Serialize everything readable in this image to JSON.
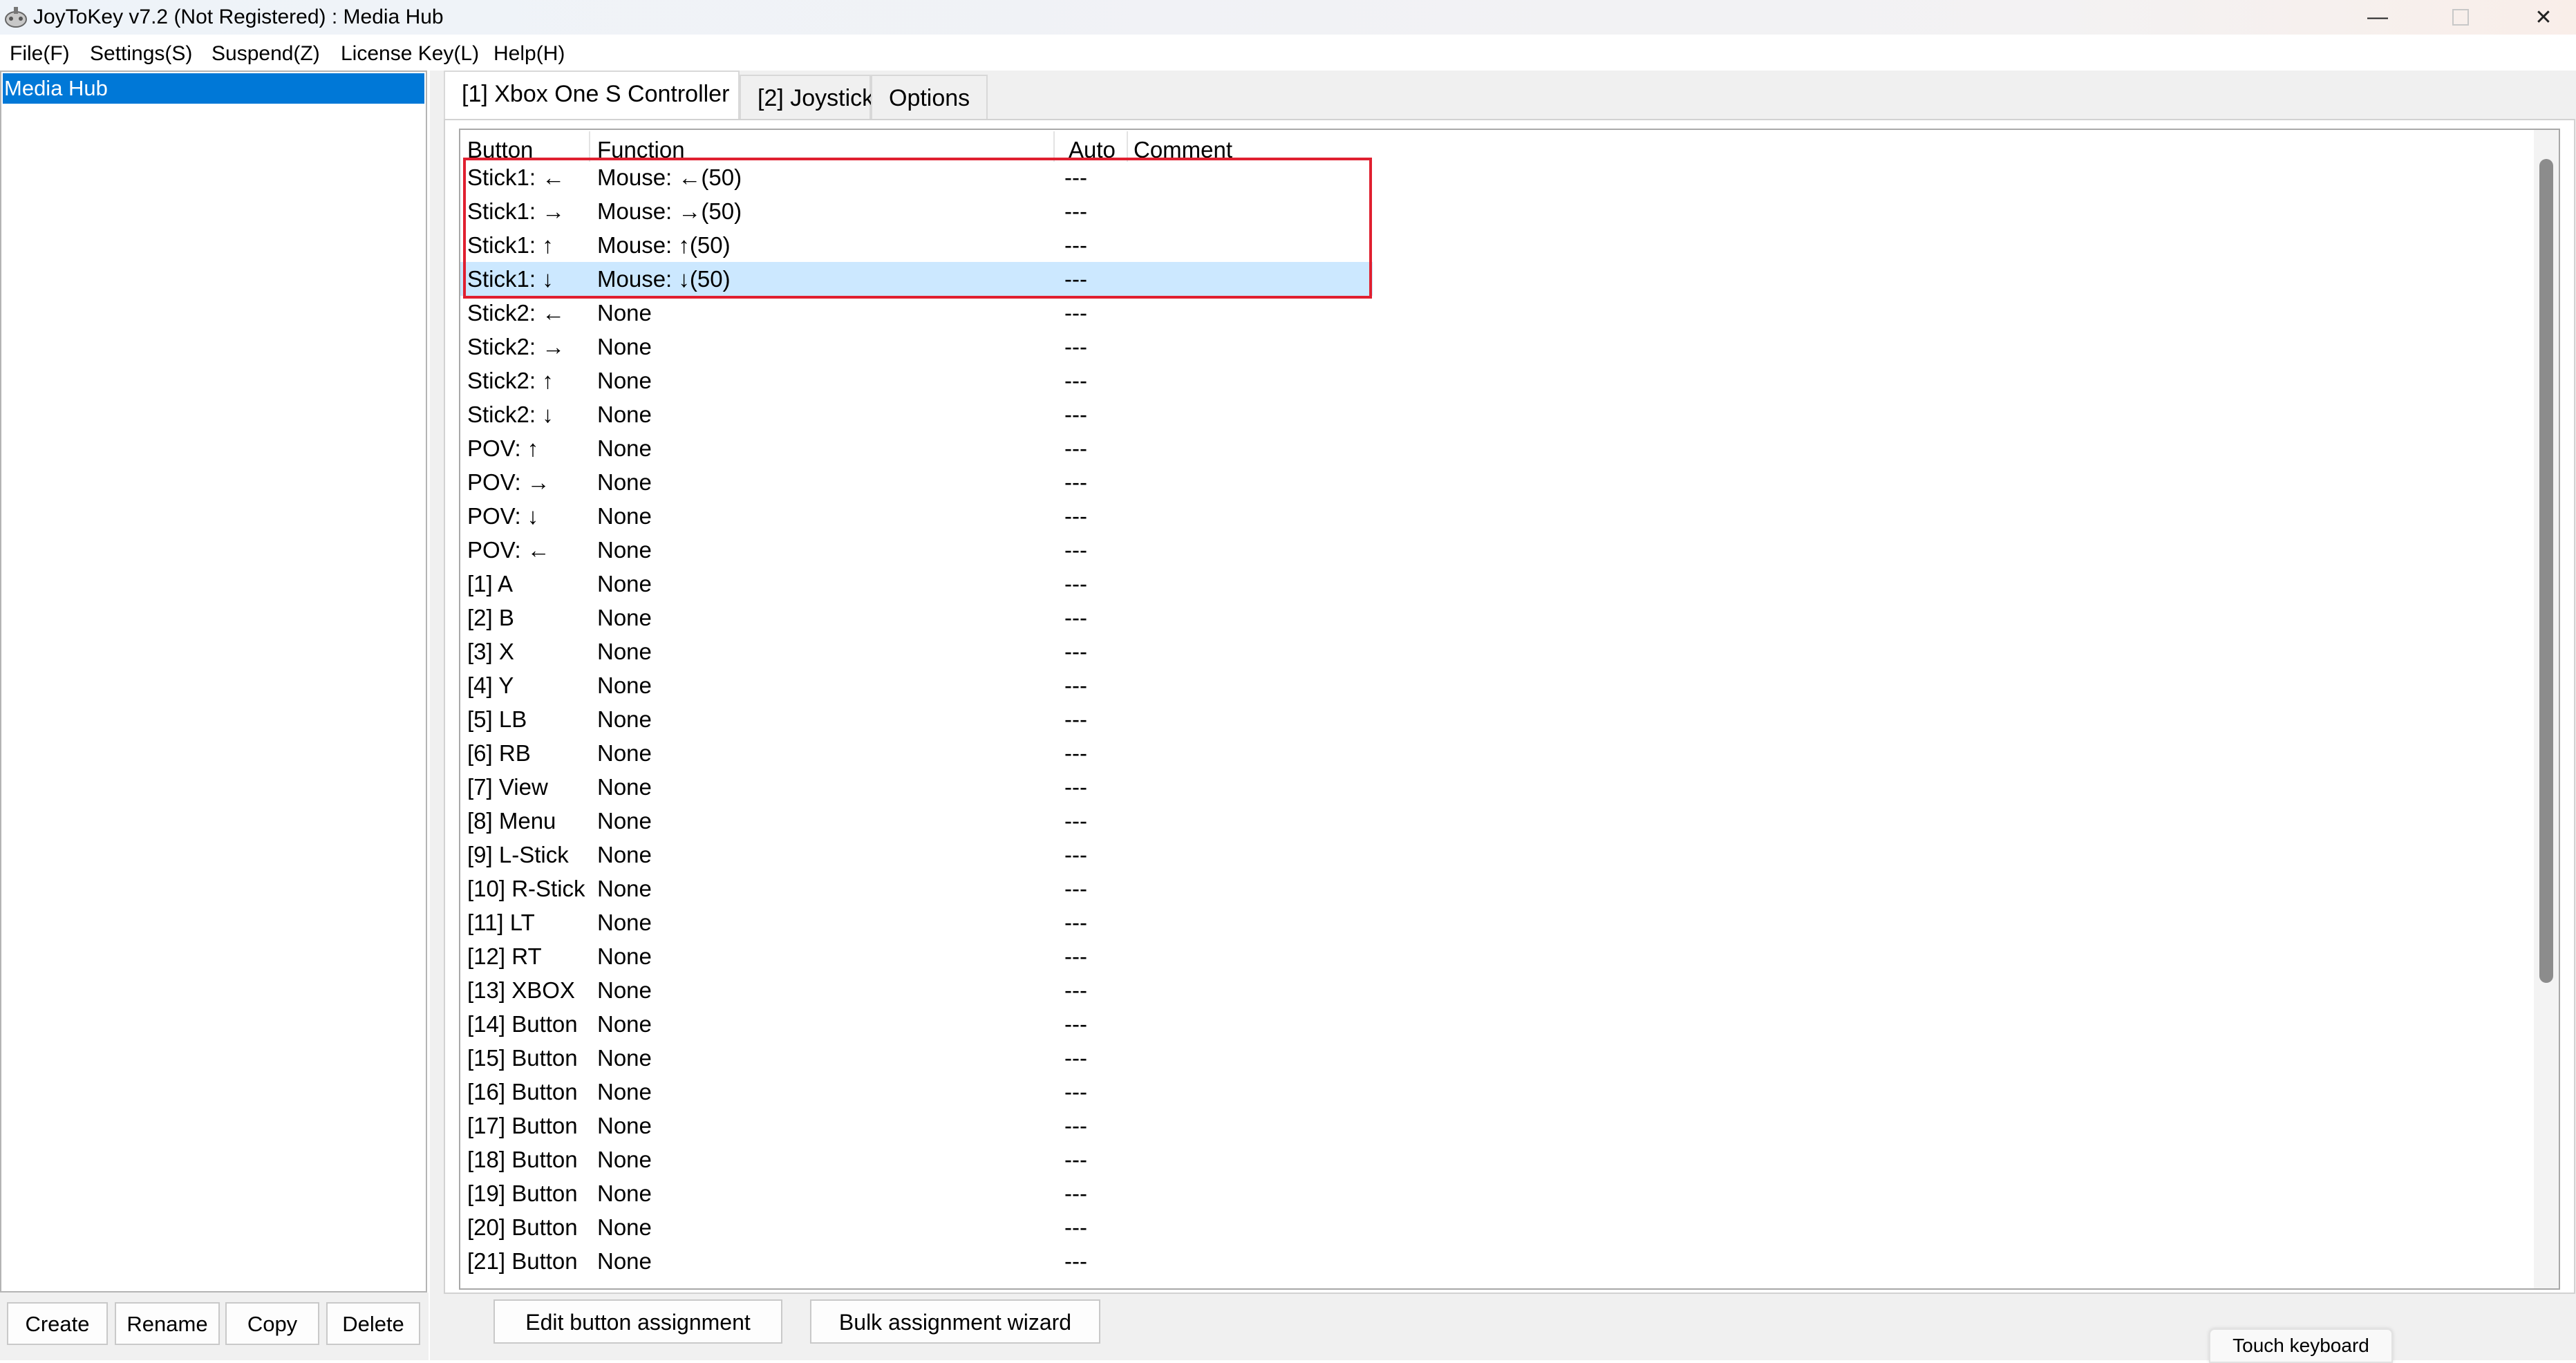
{
  "window": {
    "title": "JoyToKey v7.2 (Not Registered) : Media Hub",
    "minimize_glyph": "—",
    "close_glyph": "✕"
  },
  "menu": [
    {
      "label": "File(F)"
    },
    {
      "label": "Settings(S)"
    },
    {
      "label": "Suspend(Z)"
    },
    {
      "label": "License Key(L)"
    },
    {
      "label": "Help(H)"
    }
  ],
  "profiles": {
    "items": [
      {
        "label": "Media Hub",
        "selected": true
      }
    ],
    "buttons": {
      "create": "Create",
      "rename": "Rename",
      "copy": "Copy",
      "delete": "Delete"
    }
  },
  "tabs": [
    {
      "label": "[1] Xbox One S Controller",
      "active": true
    },
    {
      "label": "[2] Joystick",
      "active": false
    },
    {
      "label": "Options",
      "active": false
    }
  ],
  "table": {
    "headers": {
      "button": "Button",
      "function": "Function",
      "auto": "Auto",
      "comment": "Comment"
    },
    "selected_row": 3,
    "highlighted_rows": [
      0,
      1,
      2,
      3
    ],
    "rows": [
      {
        "button": "Stick1: ←",
        "function": "Mouse: ←(50)",
        "auto": "---",
        "comment": ""
      },
      {
        "button": "Stick1: →",
        "function": "Mouse: →(50)",
        "auto": "---",
        "comment": ""
      },
      {
        "button": "Stick1: ↑",
        "function": "Mouse: ↑(50)",
        "auto": "---",
        "comment": ""
      },
      {
        "button": "Stick1: ↓",
        "function": "Mouse: ↓(50)",
        "auto": "---",
        "comment": ""
      },
      {
        "button": "Stick2: ←",
        "function": "None",
        "auto": "---",
        "comment": ""
      },
      {
        "button": "Stick2: →",
        "function": "None",
        "auto": "---",
        "comment": ""
      },
      {
        "button": "Stick2: ↑",
        "function": "None",
        "auto": "---",
        "comment": ""
      },
      {
        "button": "Stick2: ↓",
        "function": "None",
        "auto": "---",
        "comment": ""
      },
      {
        "button": "POV: ↑",
        "function": "None",
        "auto": "---",
        "comment": ""
      },
      {
        "button": "POV: →",
        "function": "None",
        "auto": "---",
        "comment": ""
      },
      {
        "button": "POV: ↓",
        "function": "None",
        "auto": "---",
        "comment": ""
      },
      {
        "button": "POV: ←",
        "function": "None",
        "auto": "---",
        "comment": ""
      },
      {
        "button": "[1] A",
        "function": "None",
        "auto": "---",
        "comment": ""
      },
      {
        "button": "[2] B",
        "function": "None",
        "auto": "---",
        "comment": ""
      },
      {
        "button": "[3] X",
        "function": "None",
        "auto": "---",
        "comment": ""
      },
      {
        "button": "[4] Y",
        "function": "None",
        "auto": "---",
        "comment": ""
      },
      {
        "button": "[5] LB",
        "function": "None",
        "auto": "---",
        "comment": ""
      },
      {
        "button": "[6] RB",
        "function": "None",
        "auto": "---",
        "comment": ""
      },
      {
        "button": "[7] View",
        "function": "None",
        "auto": "---",
        "comment": ""
      },
      {
        "button": "[8] Menu",
        "function": "None",
        "auto": "---",
        "comment": ""
      },
      {
        "button": "[9] L-Stick",
        "function": "None",
        "auto": "---",
        "comment": ""
      },
      {
        "button": "[10] R-Stick",
        "function": "None",
        "auto": "---",
        "comment": ""
      },
      {
        "button": "[11] LT",
        "function": "None",
        "auto": "---",
        "comment": ""
      },
      {
        "button": "[12] RT",
        "function": "None",
        "auto": "---",
        "comment": ""
      },
      {
        "button": "[13] XBOX",
        "function": "None",
        "auto": "---",
        "comment": ""
      },
      {
        "button": "[14] Button",
        "function": "None",
        "auto": "---",
        "comment": ""
      },
      {
        "button": "[15] Button",
        "function": "None",
        "auto": "---",
        "comment": ""
      },
      {
        "button": "[16] Button",
        "function": "None",
        "auto": "---",
        "comment": ""
      },
      {
        "button": "[17] Button",
        "function": "None",
        "auto": "---",
        "comment": ""
      },
      {
        "button": "[18] Button",
        "function": "None",
        "auto": "---",
        "comment": ""
      },
      {
        "button": "[19] Button",
        "function": "None",
        "auto": "---",
        "comment": ""
      },
      {
        "button": "[20] Button",
        "function": "None",
        "auto": "---",
        "comment": ""
      },
      {
        "button": "[21] Button",
        "function": "None",
        "auto": "---",
        "comment": ""
      }
    ]
  },
  "actions": {
    "edit": "Edit button assignment",
    "bulk": "Bulk assignment wizard"
  },
  "touch_keyboard": "Touch keyboard",
  "colors": {
    "selection": "#0078d7",
    "row_selected": "#cce8ff",
    "highlight_box": "#e02030"
  }
}
